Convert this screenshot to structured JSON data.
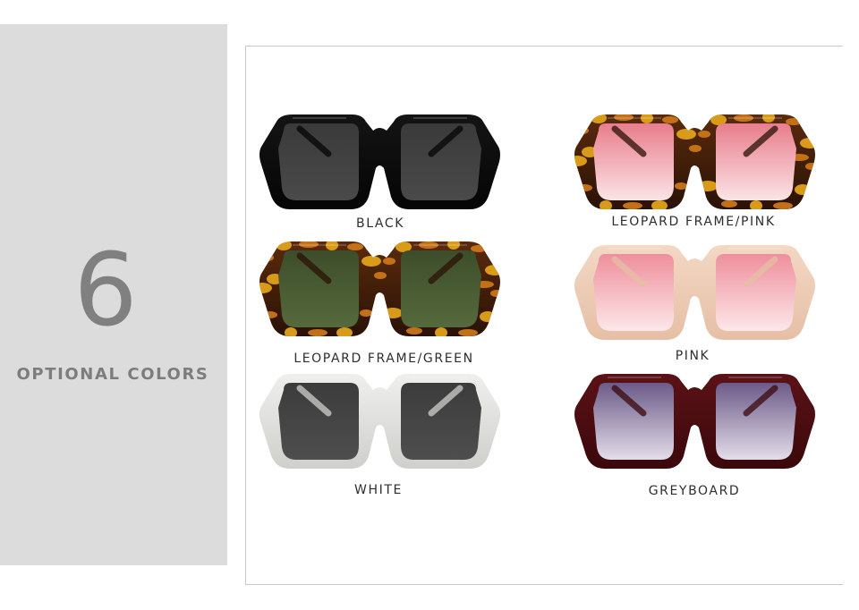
{
  "count": "6",
  "label": "OPTIONAL COLORS",
  "variants": [
    {
      "name": "BLACK",
      "frame": "#141414",
      "frame_dark": "#050505",
      "lens_top": "#3a3a3a",
      "lens_bottom": "#4a4a4a",
      "pattern": "solid"
    },
    {
      "name": "LEOPARD FRAME/PINK",
      "frame": "#5a2a0c",
      "frame_dark": "#2a1206",
      "lens_top": "#e87d8c",
      "lens_bottom": "#fbe4e6",
      "pattern": "leopard"
    },
    {
      "name": "LEOPARD FRAME/GREEN",
      "frame": "#5a2a0c",
      "frame_dark": "#2a1206",
      "lens_top": "#3d4d2a",
      "lens_bottom": "#556a3c",
      "pattern": "leopard"
    },
    {
      "name": "PINK",
      "frame": "#f3d8c4",
      "frame_dark": "#e6bfa5",
      "lens_top": "#ee8f9c",
      "lens_bottom": "#fde7e9",
      "pattern": "solid"
    },
    {
      "name": "WHITE",
      "frame": "#efefed",
      "frame_dark": "#cfcfcc",
      "lens_top": "#3c3c3c",
      "lens_bottom": "#4e4e4e",
      "pattern": "solid"
    },
    {
      "name": "GREYBOARD",
      "frame": "#5b1216",
      "frame_dark": "#3a080b",
      "lens_top": "#6b5a88",
      "lens_bottom": "#e4dde9",
      "pattern": "solid"
    }
  ]
}
